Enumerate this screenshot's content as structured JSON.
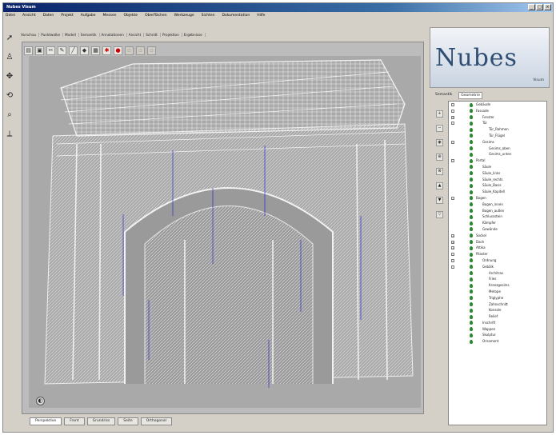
{
  "window": {
    "title": "Nubes Visum"
  },
  "menu": [
    "Datei",
    "Ansicht",
    "Daten",
    "Projekt",
    "Aufgabe",
    "Messen",
    "Objekte",
    "Oberflächen",
    "Werkzeuge",
    "Sichten",
    "Dokumentation",
    "Hilfe"
  ],
  "breadcrumb_tabs": [
    "Vorschau",
    "Punktwolke",
    "Modell",
    "Semantik",
    "Annotationen",
    "Ansicht",
    "Schnitt",
    "Projektion",
    "Ergebnisse"
  ],
  "left_tools": [
    "select-tool-icon",
    "person-tool-icon",
    "pan-tool-icon",
    "rotate-tool-icon",
    "zoom-tool-icon",
    "measure-tool-icon"
  ],
  "viewport_toolbar": [
    {
      "icon": "open-icon",
      "glyph": "▤",
      "style": ""
    },
    {
      "icon": "save-icon",
      "glyph": "▣",
      "style": ""
    },
    {
      "icon": "cut-icon",
      "glyph": "✂",
      "style": ""
    },
    {
      "icon": "brush-icon",
      "glyph": "✎",
      "style": ""
    },
    {
      "icon": "line-icon",
      "glyph": "╱",
      "style": ""
    },
    {
      "icon": "tag-icon",
      "glyph": "◆",
      "style": ""
    },
    {
      "icon": "layers-icon",
      "glyph": "▦",
      "style": ""
    },
    {
      "icon": "alert-icon",
      "glyph": "✱",
      "style": "red"
    },
    {
      "icon": "stop-icon",
      "glyph": "●",
      "style": "red"
    },
    {
      "icon": "disabled-a-icon",
      "glyph": "▫",
      "style": "dim"
    },
    {
      "icon": "disabled-b-icon",
      "glyph": "▫",
      "style": "dim"
    },
    {
      "icon": "disabled-c-icon",
      "glyph": "▫",
      "style": "dim"
    }
  ],
  "viewport_caption": "",
  "bottom_tabs": [
    "Perspektive",
    "Front",
    "Grundriss",
    "Seite",
    "Orthogonal"
  ],
  "logo": {
    "word": "Nubes",
    "sub": "Visum"
  },
  "tree_tabs": [
    "Semantik",
    "Geometrie"
  ],
  "tree_rows": [
    {
      "label": "Gebäude",
      "indent": 0,
      "pm": "-"
    },
    {
      "label": "Fassade",
      "indent": 0,
      "pm": "-"
    },
    {
      "label": "Fenster",
      "indent": 1,
      "pm": "+"
    },
    {
      "label": "Tür",
      "indent": 1,
      "pm": "-"
    },
    {
      "label": "Tür_Rahmen",
      "indent": 2,
      "pm": ""
    },
    {
      "label": "Tür_Flügel",
      "indent": 2,
      "pm": ""
    },
    {
      "label": "Gesims",
      "indent": 1,
      "pm": "-"
    },
    {
      "label": "Gesims_oben",
      "indent": 2,
      "pm": ""
    },
    {
      "label": "Gesims_unten",
      "indent": 2,
      "pm": ""
    },
    {
      "label": "Portal",
      "indent": 0,
      "pm": "-"
    },
    {
      "label": "Säule",
      "indent": 1,
      "pm": ""
    },
    {
      "label": "Säule_links",
      "indent": 1,
      "pm": ""
    },
    {
      "label": "Säule_rechts",
      "indent": 1,
      "pm": ""
    },
    {
      "label": "Säule_Basis",
      "indent": 1,
      "pm": ""
    },
    {
      "label": "Säule_Kapitell",
      "indent": 1,
      "pm": ""
    },
    {
      "label": "Bogen",
      "indent": 0,
      "pm": "-"
    },
    {
      "label": "Bogen_innen",
      "indent": 1,
      "pm": ""
    },
    {
      "label": "Bogen_außen",
      "indent": 1,
      "pm": ""
    },
    {
      "label": "Schlussstein",
      "indent": 1,
      "pm": ""
    },
    {
      "label": "Kämpfer",
      "indent": 1,
      "pm": ""
    },
    {
      "label": "Gewände",
      "indent": 1,
      "pm": ""
    },
    {
      "label": "Sockel",
      "indent": 0,
      "pm": "+"
    },
    {
      "label": "Dach",
      "indent": 0,
      "pm": "+"
    },
    {
      "label": "Attika",
      "indent": 0,
      "pm": "+"
    },
    {
      "label": "Pilaster",
      "indent": 0,
      "pm": "-"
    },
    {
      "label": "Ordnung",
      "indent": 1,
      "pm": "-"
    },
    {
      "label": "Gebälk",
      "indent": 1,
      "pm": "-"
    },
    {
      "label": "Architrav",
      "indent": 2,
      "pm": ""
    },
    {
      "label": "Fries",
      "indent": 2,
      "pm": ""
    },
    {
      "label": "Kranzgesims",
      "indent": 2,
      "pm": ""
    },
    {
      "label": "Metope",
      "indent": 2,
      "pm": ""
    },
    {
      "label": "Triglyphe",
      "indent": 2,
      "pm": ""
    },
    {
      "label": "Zahnschnitt",
      "indent": 2,
      "pm": ""
    },
    {
      "label": "Konsole",
      "indent": 2,
      "pm": ""
    },
    {
      "label": "Relief",
      "indent": 2,
      "pm": ""
    },
    {
      "label": "Inschrift",
      "indent": 1,
      "pm": ""
    },
    {
      "label": "Wappen",
      "indent": 1,
      "pm": ""
    },
    {
      "label": "Skulptur",
      "indent": 1,
      "pm": ""
    },
    {
      "label": "Ornament",
      "indent": 1,
      "pm": ""
    }
  ],
  "colors": {
    "annotation": "#1a1ad8",
    "titlebar": "#0a246a",
    "visible_eye": "#2c8a2c"
  }
}
